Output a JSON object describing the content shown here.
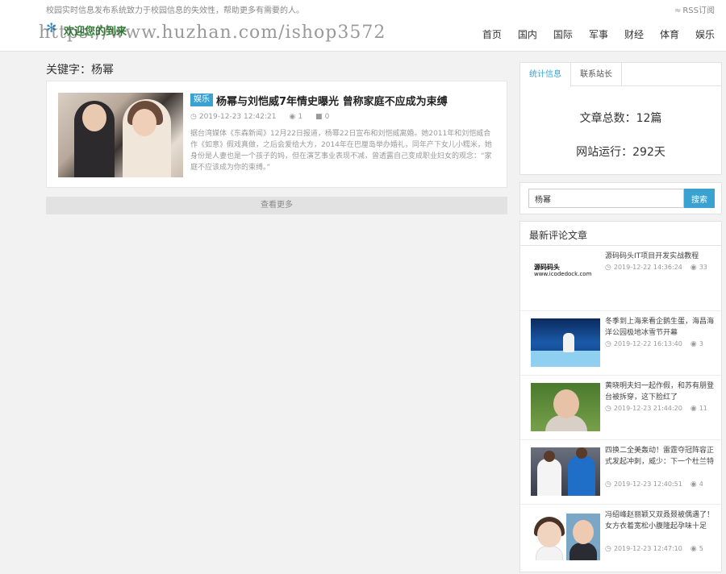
{
  "topbar": {
    "slogan": "校园实时信息发布系统致力于校园信息的失效性，帮助更多有需要的人。",
    "rss_label": "RSS订阅"
  },
  "header": {
    "logo_text": "欢迎您的到来",
    "watermark": "https://www.huzhan.com/ishop3572",
    "nav": [
      "首页",
      "国内",
      "国际",
      "军事",
      "财经",
      "体育",
      "娱乐"
    ]
  },
  "main": {
    "keyword_title": "关键字：杨幂",
    "article": {
      "tag": "娱乐",
      "title": "杨幂与刘恺威7年情史曝光 曾称家庭不应成为束缚",
      "date": "2019-12-23 12:42:21",
      "views": "1",
      "comments": "0",
      "excerpt": "据台湾媒体《东森新闻》12月22日报道，杨幂22日宣布和刘恺威离婚。她2011年和刘恺威合作《如意》假戏真做，之后会爱给大方，2014年在巴厘岛举办婚礼，同年产下女儿小糯米，她身份是人妻也是一个孩子的妈，但在演艺事业表现不减，曾透露自己变成职业妇女的观念：“家庭不应该成为你的束缚。”"
    },
    "load_more": "查看更多"
  },
  "sidebar": {
    "tabs": [
      "统计信息",
      "联系站长"
    ],
    "stats": {
      "articles": "文章总数：12篇",
      "uptime": "网站运行：292天"
    },
    "search": {
      "value": "杨幂",
      "button": "搜索"
    },
    "recent": {
      "title": "最新评论文章",
      "items": [
        {
          "title": "源码码头IT项目开发实战教程",
          "date": "2019-12-22 14:36:24",
          "views": "33",
          "thumb_brand": "源码码头",
          "thumb_url": "www.icodedock.com"
        },
        {
          "title": "冬季到上海来看企鹅生蛋，海昌海洋公园极地冰雪节开幕",
          "date": "2019-12-22 16:13:40",
          "views": "3"
        },
        {
          "title": "黄晓明夫妇一起作假，和苏有朋登台被拆穿，这下脸红了",
          "date": "2019-12-23 21:44:20",
          "views": "11"
        },
        {
          "title": "四换二全美轰动！雷霆夺冠阵容正式发起冲刺，威少：下一个杜兰特",
          "date": "2019-12-23 12:40:51",
          "views": "4"
        },
        {
          "title": "冯绍峰赵丽颖又双叒叕被偶遇了！女方衣着宽松小腹隆起孕味十足",
          "date": "2019-12-23 12:47:10",
          "views": "5"
        }
      ]
    }
  },
  "colors": {
    "accent": "#3aa2d1",
    "background": "#f2f2f2"
  }
}
